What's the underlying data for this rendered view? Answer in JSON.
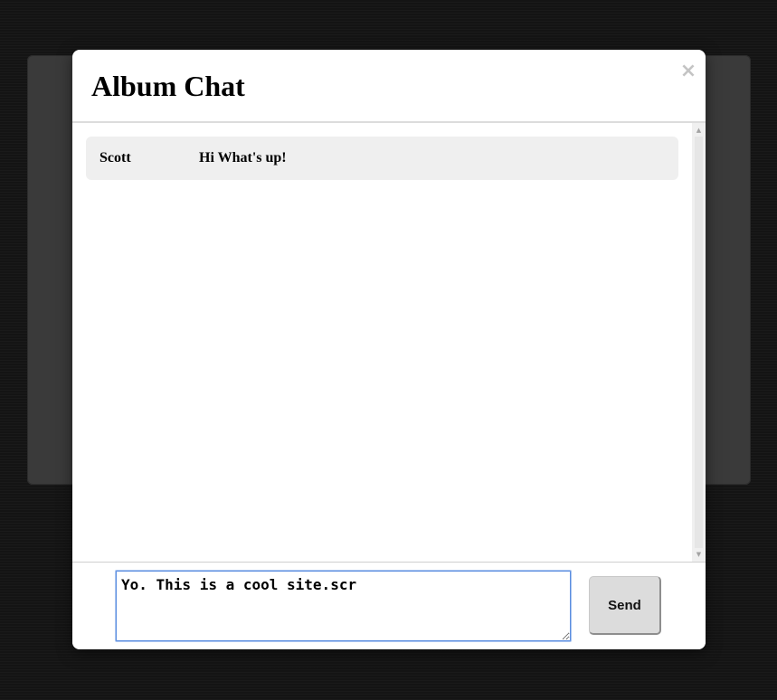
{
  "modal": {
    "title": "Album Chat",
    "close_label": "×"
  },
  "messages": [
    {
      "author": "Scott",
      "text": "Hi What's up!"
    }
  ],
  "scrollbar": {
    "up_arrow": "▲",
    "down_arrow": "▼"
  },
  "composer": {
    "input_value": "Yo. This is a cool site.scr",
    "send_label": "Send"
  },
  "colors": {
    "page_background": "#141414",
    "backdrop_panel": "#3a3a3a",
    "message_row_background": "#efefef",
    "input_focus_border": "#5a8de0",
    "send_button_background": "#dcdcdc"
  },
  "icons": {
    "close": "close-icon",
    "scroll_up": "scroll-up-arrow-icon",
    "scroll_down": "scroll-down-arrow-icon"
  }
}
